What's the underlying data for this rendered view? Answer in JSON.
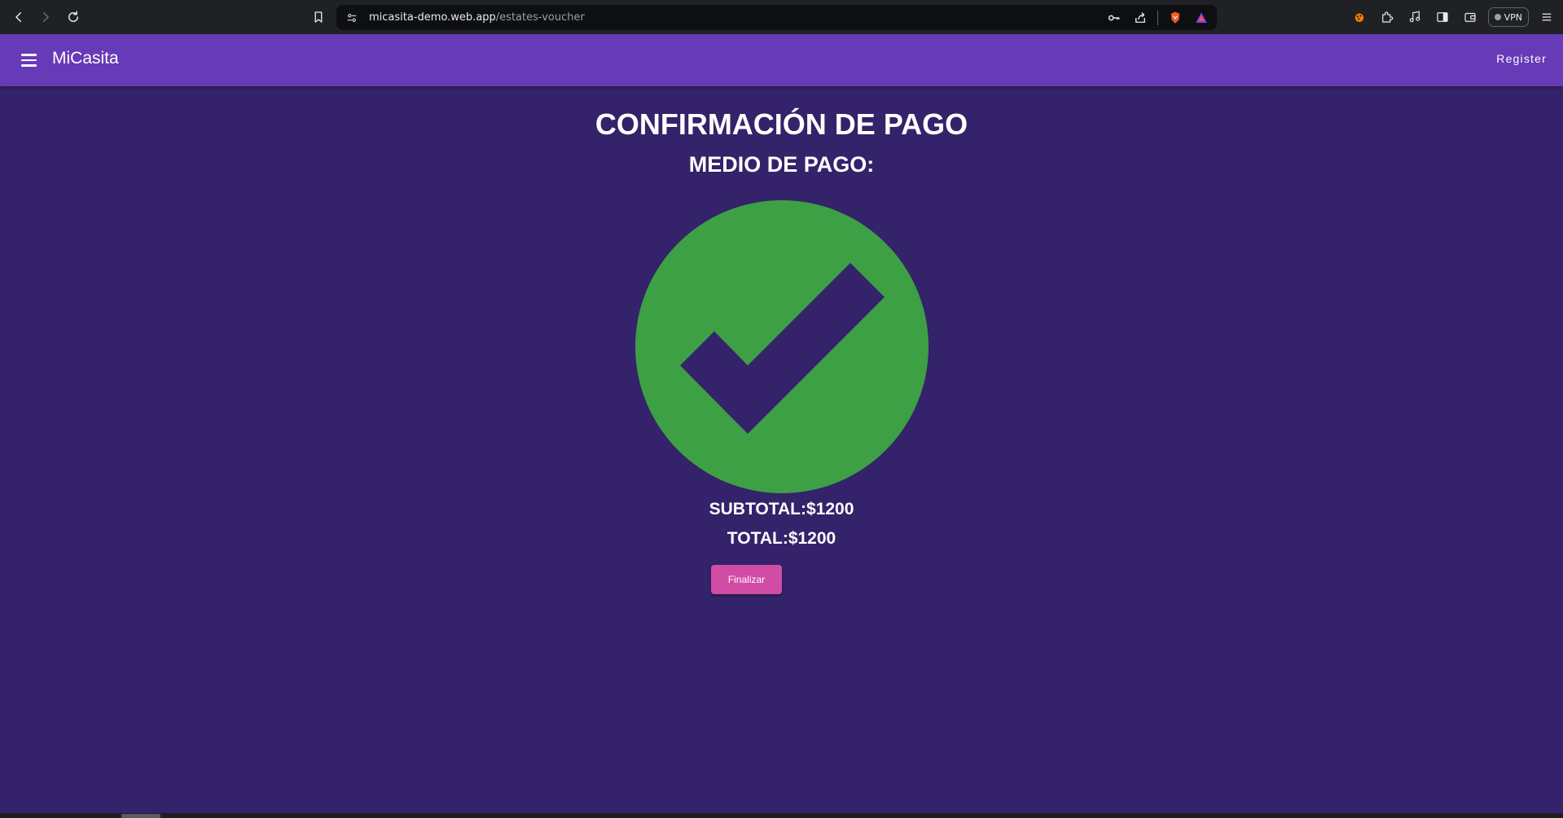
{
  "browser": {
    "url_host": "micasita-demo.web.app",
    "url_path": "/estates-voucher",
    "vpn_label": "VPN"
  },
  "appbar": {
    "brand": "MiCasita",
    "register_label": "Register",
    "color": "#673ab7"
  },
  "page": {
    "title": "CONFIRMACIÓN DE PAGO",
    "subtitle": "MEDIO DE PAGO:",
    "subtotal": "SUBTOTAL:$1200",
    "total": "TOTAL:$1200",
    "finish_label": "Finalizar",
    "background": "#34226a",
    "check_color": "#3ea044",
    "button_color": "#d14ca5"
  }
}
